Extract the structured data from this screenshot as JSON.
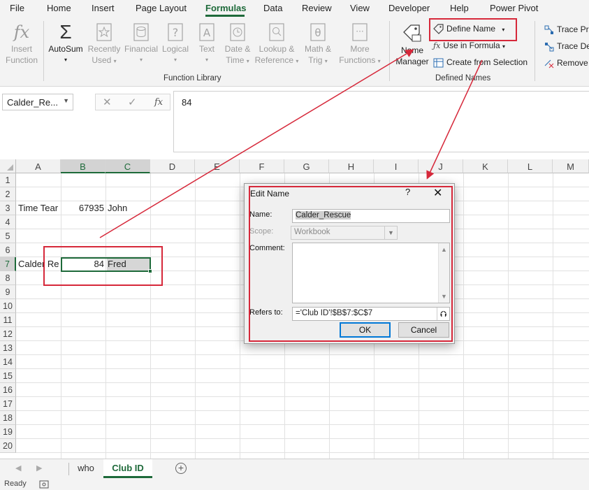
{
  "menu": {
    "tabs": [
      "File",
      "Home",
      "Insert",
      "Page Layout",
      "Formulas",
      "Data",
      "Review",
      "View",
      "Developer",
      "Help",
      "Power Pivot"
    ],
    "active": "Formulas"
  },
  "ribbon": {
    "function_library": {
      "insert_function": [
        "Insert",
        "Function"
      ],
      "autosum": "AutoSum",
      "recently_used": [
        "Recently",
        "Used"
      ],
      "financial": "Financial",
      "logical": "Logical",
      "text": "Text",
      "date_time": [
        "Date &",
        "Time"
      ],
      "lookup_reference": [
        "Lookup &",
        "Reference"
      ],
      "math_trig": [
        "Math &",
        "Trig"
      ],
      "more_functions": [
        "More",
        "Functions"
      ],
      "group_label": "Function Library"
    },
    "defined_names": {
      "name_manager": [
        "Name",
        "Manager"
      ],
      "define_name": "Define Name",
      "use_in_formula": "Use in Formula",
      "create_from_selection": "Create from Selection",
      "group_label": "Defined Names"
    },
    "formula_auditing": {
      "trace_precedents": "Trace Pre",
      "trace_dependents": "Trace De",
      "remove_arrows": "Remove"
    }
  },
  "formula_bar": {
    "name_box": "Calder_Re...",
    "value": "84"
  },
  "sheet": {
    "columns": [
      "A",
      "B",
      "C",
      "D",
      "E",
      "F",
      "G",
      "H",
      "I",
      "J",
      "K",
      "L",
      "M"
    ],
    "rows": [
      "1",
      "2",
      "3",
      "4",
      "5",
      "6",
      "7",
      "8",
      "9",
      "10",
      "11",
      "12",
      "13",
      "14",
      "15",
      "16",
      "17",
      "18",
      "19",
      "20"
    ],
    "cells": {
      "a3": "Time Tear",
      "b3": "67935",
      "c3": "John",
      "a7": "Calder Re",
      "b7": "84",
      "c7": "Fred"
    }
  },
  "sheet_tabs": [
    "who",
    "Club ID"
  ],
  "active_sheet": "Club ID",
  "status": "Ready",
  "dialog": {
    "title": "Edit Name",
    "help": "?",
    "name_label": "Name:",
    "name_value": "Calder_Rescue",
    "scope_label": "Scope:",
    "scope_value": "Workbook",
    "comment_label": "Comment:",
    "refers_label": "Refers to:",
    "refers_value": "='Club ID'!$B$7:$C$7",
    "ok": "OK",
    "cancel": "Cancel"
  },
  "colors": {
    "accent": "#1e6a3a",
    "annotation": "#d6283a"
  }
}
